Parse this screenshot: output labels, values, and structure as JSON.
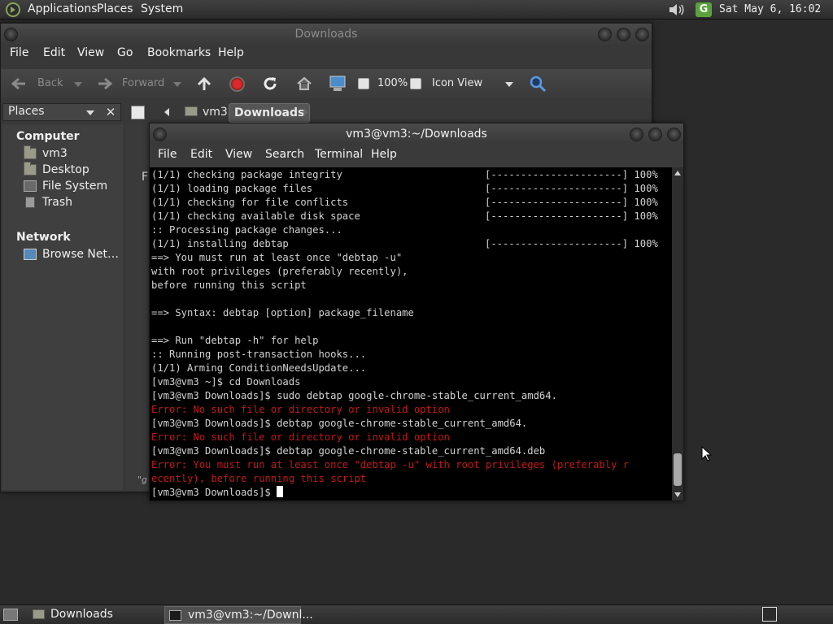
{
  "top_panel": {
    "menus": [
      "Applications",
      "Places",
      "System"
    ],
    "updates_badge": "G",
    "clock": "Sat May  6, 16:02"
  },
  "file_manager": {
    "title": "Downloads",
    "menus": [
      "File",
      "Edit",
      "View",
      "Go",
      "Bookmarks",
      "Help"
    ],
    "toolbar": {
      "back": "Back",
      "forward": "Forward",
      "zoom": "100%",
      "view_mode": "Icon View"
    },
    "sidebar": {
      "selector": "Places",
      "sections": [
        {
          "heading": "Computer",
          "items": [
            "vm3",
            "Desktop",
            "File System",
            "Trash"
          ]
        },
        {
          "heading": "Network",
          "items": [
            "Browse Net…"
          ]
        }
      ]
    },
    "path": [
      "vm3",
      "Downloads"
    ],
    "content_stub_1": "F",
    "content_stub_2": "\"g"
  },
  "terminal": {
    "title": "vm3@vm3:~/Downloads",
    "menus": [
      "File",
      "Edit",
      "View",
      "Search",
      "Terminal",
      "Help"
    ],
    "lines": [
      {
        "text": "(1/1) checking package integrity",
        "progress": "[----------------------] 100%"
      },
      {
        "text": "(1/1) loading package files",
        "progress": "[----------------------] 100%"
      },
      {
        "text": "(1/1) checking for file conflicts",
        "progress": "[----------------------] 100%"
      },
      {
        "text": "(1/1) checking available disk space",
        "progress": "[----------------------] 100%"
      },
      {
        "text": ":: Processing package changes..."
      },
      {
        "text": "(1/1) installing debtap",
        "progress": "[----------------------] 100%"
      },
      {
        "text": "==> You must run at least once \"debtap -u\""
      },
      {
        "text": "with root privileges (preferably recently),"
      },
      {
        "text": "before running this script"
      },
      {
        "text": ""
      },
      {
        "text": "==> Syntax: debtap [option] package_filename"
      },
      {
        "text": ""
      },
      {
        "text": "==> Run \"debtap -h\" for help"
      },
      {
        "text": ":: Running post-transaction hooks..."
      },
      {
        "text": "(1/1) Arming ConditionNeedsUpdate..."
      },
      {
        "text": "[vm3@vm3 ~]$ cd Downloads"
      },
      {
        "text": "[vm3@vm3 Downloads]$ sudo debtap google-chrome-stable_current_amd64."
      },
      {
        "text": "Error: No such file or directory or invalid option",
        "error": true
      },
      {
        "text": "[vm3@vm3 Downloads]$ debtap google-chrome-stable_current_amd64."
      },
      {
        "text": "Error: No such file or directory or invalid option",
        "error": true
      },
      {
        "text": "[vm3@vm3 Downloads]$ debtap google-chrome-stable_current_amd64.deb"
      },
      {
        "text": "Error: You must run at least once \"debtap -u\" with root privileges (preferably r",
        "error": true
      },
      {
        "text": "ecently), before running this script",
        "error": true
      },
      {
        "text": "[vm3@vm3 Downloads]$ ",
        "cursor": true
      }
    ]
  },
  "taskbar": {
    "tasks": [
      "Downloads",
      "vm3@vm3:~/Downl..."
    ]
  },
  "colors": {
    "terminal_bg": "#000000",
    "terminal_text": "#d2d2d2",
    "terminal_error": "#c41717",
    "panel_bg": "#333333"
  }
}
